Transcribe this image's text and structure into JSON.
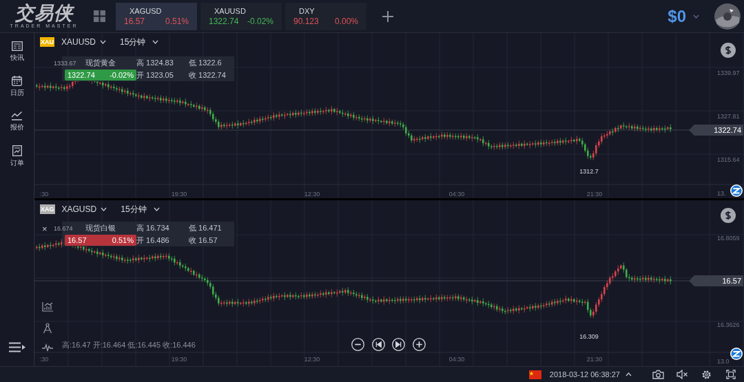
{
  "logo": {
    "name": "交易侠",
    "tagline": "TRADER MASTER"
  },
  "tickers": [
    {
      "symbol": "XAGUSD",
      "price": "16.57",
      "change": "0.51%",
      "color": "#e0525a",
      "selected": true
    },
    {
      "symbol": "XAUUSD",
      "price": "1322.74",
      "change": "-0.02%",
      "color": "#44b654",
      "selected": false
    },
    {
      "symbol": "DXY",
      "price": "90.123",
      "change": "0.00%",
      "color": "#e0525a",
      "selected": false
    }
  ],
  "balance": "$0",
  "sidebar": [
    {
      "label": "快讯"
    },
    {
      "label": "日历"
    },
    {
      "label": "报价"
    },
    {
      "label": "订单"
    }
  ],
  "charts": [
    {
      "badge": "XAU",
      "symbol": "XAUUSD",
      "interval": "15分钟",
      "marker_price": "1333.67",
      "info": {
        "name": "现货黄金",
        "price": "1322.74",
        "change": "-0.02%",
        "color": "#2f9a45",
        "high_label": "高",
        "high": "1324.83",
        "low_label": "低",
        "low": "1322.6",
        "open_label": "开",
        "open": "1323.05",
        "close_label": "收",
        "close": "1322.74"
      },
      "y_labels": [
        "1339.97",
        "1327.81",
        "1315.64",
        "13."
      ],
      "last_price": "1322.74",
      "min_label": "1312.7",
      "x_labels": [
        ":30",
        "19:30",
        "12:30",
        "04:30",
        "21:30"
      ]
    },
    {
      "badge": "XAG",
      "symbol": "XAGUSD",
      "interval": "15分钟",
      "close": "×",
      "marker_price": "16.674",
      "info": {
        "name": "现货白银",
        "price": "16.57",
        "change": "0.51%",
        "color": "#b8343c",
        "high_label": "高",
        "high": "16.734",
        "low_label": "低",
        "low": "16.471",
        "open_label": "开",
        "open": "16.486",
        "close_label": "收",
        "close": "16.57"
      },
      "y_labels": [
        "16.8059",
        "16.3626",
        "13.0"
      ],
      "last_price": "16.57",
      "min_label": "16.309",
      "x_labels": [
        ":30",
        "19:30",
        "12:30",
        "04:30",
        "21:30"
      ],
      "footer": "高:16.47 开:16.464 低:16.445 收:16.446"
    }
  ],
  "status_bar": {
    "datetime": "2018-03-12 06:38:27"
  }
}
